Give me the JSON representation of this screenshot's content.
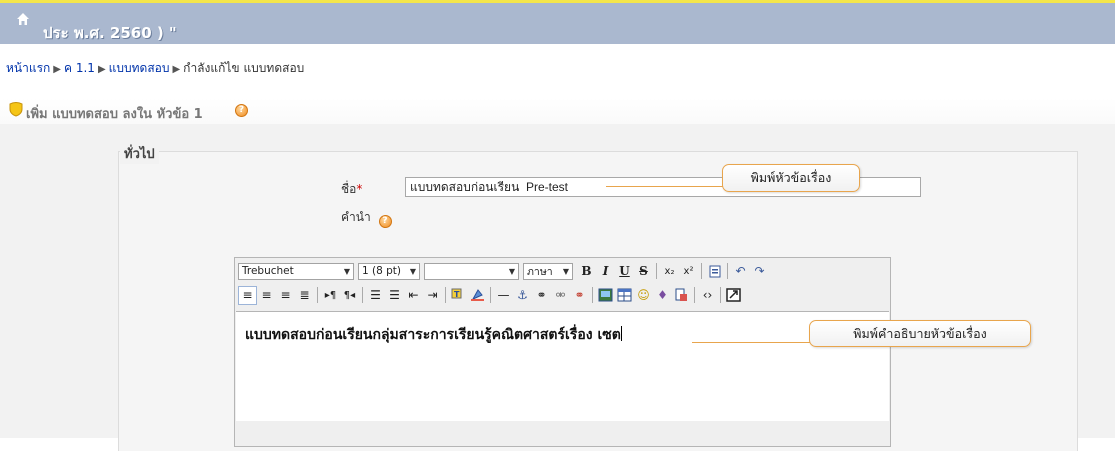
{
  "header": {
    "site_title": "ประ พ.ศ. 2560 ) \""
  },
  "breadcrumb": {
    "items": [
      "หน้าแรก",
      "ค 1.1",
      "แบบทดสอบ"
    ],
    "current": "กำลังแก้ไข แบบทดสอบ",
    "separator": "▶"
  },
  "page_heading": {
    "text": "เพิ่ม แบบทดสอบ ลงใน หัวข้อ 1"
  },
  "form": {
    "section_legend": "ทั่วไป",
    "name_label": "ชื่อ",
    "required_mark": "*",
    "name_value": "แบบทดสอบก่อนเรียน  Pre-test",
    "intro_label": "คำนำ"
  },
  "editor": {
    "font_family": "Trebuchet",
    "font_size": "1 (8 pt)",
    "heading_select": "",
    "language": "ภาษา",
    "content": "แบบทดสอบก่อนเรียนกลุ่มสาระการเรียนรู้คณิตศาสตร์เรื่อง เซต"
  },
  "callouts": {
    "name_hint": "พิมพ์หัวข้อเรื่อง",
    "intro_hint": "พิมพ์คำอธิบายหัวข้อเรื่อง"
  },
  "colors": {
    "header_bg": "#aab8cf",
    "header_accent": "#f4e64a",
    "link": "#0033aa",
    "callout_border": "#e8a54d",
    "help_icon": "#f08a1c"
  }
}
